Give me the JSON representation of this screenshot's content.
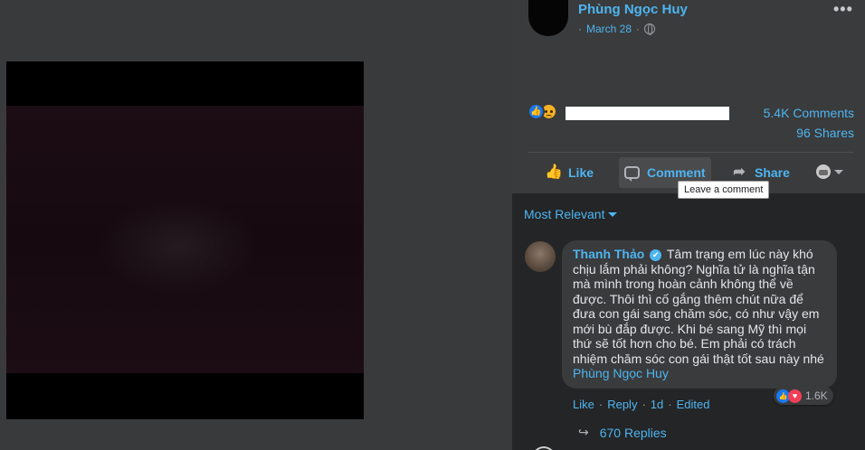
{
  "post": {
    "author": "Phùng Ngọc Huy",
    "date": "March 28",
    "privacy_icon": "globe-icon",
    "more_label": "•••"
  },
  "stats": {
    "comments": "5.4K Comments",
    "shares": "96 Shares",
    "reactions": [
      "like",
      "sad"
    ]
  },
  "actions": {
    "like": "Like",
    "comment": "Comment",
    "share": "Share",
    "tooltip": "Leave a comment"
  },
  "sort": {
    "label": "Most Relevant"
  },
  "comment": {
    "author": "Thanh Thảo",
    "verified_mark": "✔",
    "text": "Tâm trạng em lúc này khó chịu lắm phải không? Nghĩa tử là nghĩa tận mà mình trong hoàn cảnh không thể về được. Thôi thì cố gắng thêm chút nữa để đưa con gái sang chăm sóc, có như vậy em mới bù đắp được. Khi bé sang Mỹ thì mọi thứ sẽ tốt hơn cho bé. Em phải có trách nhiệm chăm sóc con gái thật tốt sau này nhé",
    "tag": "Phùng Ngọc Huy",
    "reaction_count": "1.6K",
    "like_label": "Like",
    "reply_label": "Reply",
    "time": "1d",
    "edited_label": "Edited",
    "replies_label": "670 Replies"
  },
  "colors": {
    "accent": "#4db5f1",
    "panel_bg": "#3a3b3c",
    "comments_bg": "#242526",
    "like_blue": "#1877f2",
    "love_red": "#f33e58",
    "sad_yellow": "#f7b125"
  }
}
